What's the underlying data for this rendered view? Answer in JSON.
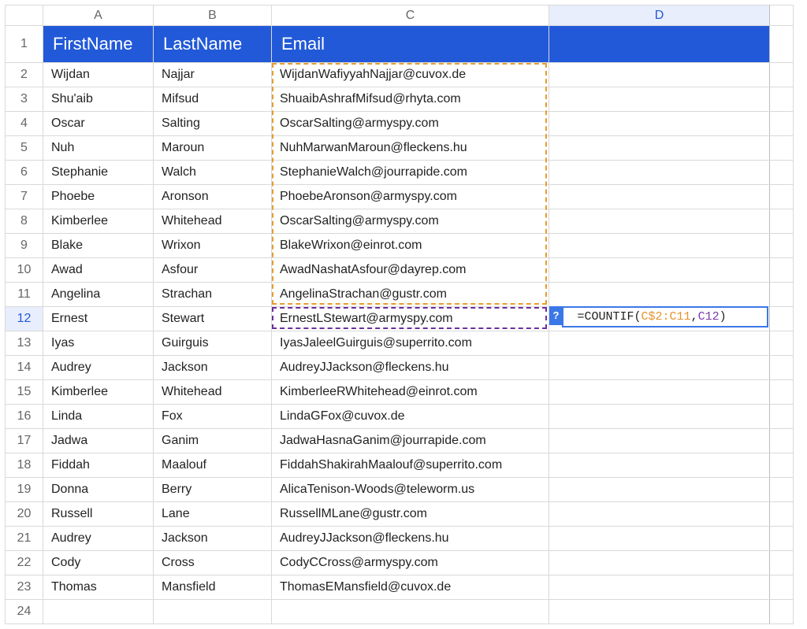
{
  "columns": [
    "A",
    "B",
    "C",
    "D"
  ],
  "headers": {
    "A": "FirstName",
    "B": "LastName",
    "C": "Email"
  },
  "rows": [
    {
      "n": 1
    },
    {
      "n": 2,
      "A": "Wijdan",
      "B": "Najjar",
      "C": "WijdanWafiyyahNajjar@cuvox.de"
    },
    {
      "n": 3,
      "A": "Shu'aib",
      "B": "Mifsud",
      "C": "ShuaibAshrafMifsud@rhyta.com"
    },
    {
      "n": 4,
      "A": "Oscar",
      "B": "Salting",
      "C": "OscarSalting@armyspy.com"
    },
    {
      "n": 5,
      "A": "Nuh",
      "B": "Maroun",
      "C": "NuhMarwanMaroun@fleckens.hu"
    },
    {
      "n": 6,
      "A": "Stephanie",
      "B": "Walch",
      "C": "StephanieWalch@jourrapide.com"
    },
    {
      "n": 7,
      "A": "Phoebe",
      "B": "Aronson",
      "C": "PhoebeAronson@armyspy.com"
    },
    {
      "n": 8,
      "A": "Kimberlee",
      "B": "Whitehead",
      "C": "OscarSalting@armyspy.com"
    },
    {
      "n": 9,
      "A": "Blake",
      "B": "Wrixon",
      "C": "BlakeWrixon@einrot.com"
    },
    {
      "n": 10,
      "A": "Awad",
      "B": "Asfour",
      "C": "AwadNashatAsfour@dayrep.com"
    },
    {
      "n": 11,
      "A": "Angelina",
      "B": "Strachan",
      "C": "AngelinaStrachan@gustr.com"
    },
    {
      "n": 12,
      "A": "Ernest",
      "B": "Stewart",
      "C": "ErnestLStewart@armyspy.com"
    },
    {
      "n": 13,
      "A": "Iyas",
      "B": "Guirguis",
      "C": "IyasJaleelGuirguis@superrito.com"
    },
    {
      "n": 14,
      "A": "Audrey",
      "B": "Jackson",
      "C": "AudreyJJackson@fleckens.hu"
    },
    {
      "n": 15,
      "A": "Kimberlee",
      "B": "Whitehead",
      "C": "KimberleeRWhitehead@einrot.com"
    },
    {
      "n": 16,
      "A": "Linda",
      "B": "Fox",
      "C": "LindaGFox@cuvox.de"
    },
    {
      "n": 17,
      "A": "Jadwa",
      "B": "Ganim",
      "C": "JadwaHasnaGanim@jourrapide.com"
    },
    {
      "n": 18,
      "A": "Fiddah",
      "B": "Maalouf",
      "C": "FiddahShakirahMaalouf@superrito.com"
    },
    {
      "n": 19,
      "A": "Donna",
      "B": "Berry",
      "C": "AlicaTenison-Woods@teleworm.us"
    },
    {
      "n": 20,
      "A": "Russell",
      "B": "Lane",
      "C": "RussellMLane@gustr.com"
    },
    {
      "n": 21,
      "A": "Audrey",
      "B": "Jackson",
      "C": "AudreyJJackson@fleckens.hu"
    },
    {
      "n": 22,
      "A": "Cody",
      "B": "Cross",
      "C": "CodyCCross@armyspy.com"
    },
    {
      "n": 23,
      "A": "Thomas",
      "B": "Mansfield",
      "C": "ThomasEMansfield@cuvox.de"
    },
    {
      "n": 24
    }
  ],
  "active_cell": "D12",
  "formula": {
    "eq": "=",
    "fn": "COUNTIF",
    "open": "(",
    "range": "C$2:C11",
    "comma": ",",
    "ref": "C12",
    "close": ")",
    "help_icon": "?"
  },
  "highlight": {
    "orange_range": "C2:C11",
    "purple_range": "C12"
  }
}
